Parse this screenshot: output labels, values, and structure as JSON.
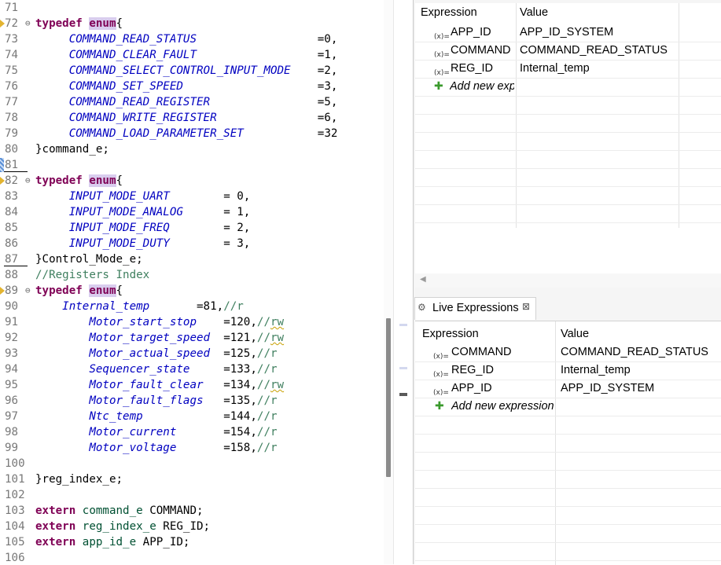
{
  "editor": {
    "lines": [
      {
        "n": "71"
      },
      {
        "n": "72",
        "fold": "⊖",
        "marker": "yellow",
        "kw": "typedef ",
        "kwh": "enum",
        "rest": "{"
      },
      {
        "n": "73",
        "indent": "     ",
        "cst": "COMMAND_READ_STATUS",
        "pad": "                  ",
        "val": "=0,"
      },
      {
        "n": "74",
        "indent": "     ",
        "cst": "COMMAND_CLEAR_FAULT",
        "pad": "                  ",
        "val": "=1,"
      },
      {
        "n": "75",
        "indent": "     ",
        "cst": "COMMAND_SELECT_CONTROL_INPUT_MODE",
        "pad": "    ",
        "val": "=2,"
      },
      {
        "n": "76",
        "indent": "     ",
        "cst": "COMMAND_SET_SPEED",
        "pad": "                    ",
        "val": "=3,"
      },
      {
        "n": "77",
        "indent": "     ",
        "cst": "COMMAND_READ_REGISTER",
        "pad": "                ",
        "val": "=5,"
      },
      {
        "n": "78",
        "indent": "     ",
        "cst": "COMMAND_WRITE_REGISTER",
        "pad": "               ",
        "val": "=6,"
      },
      {
        "n": "79",
        "indent": "     ",
        "cst": "COMMAND_LOAD_PARAMETER_SET",
        "pad": "           ",
        "val": "=32"
      },
      {
        "n": "80",
        "plain": "}command_e;"
      },
      {
        "n": "81",
        "marker": "blue",
        "underline": true
      },
      {
        "n": "82",
        "fold": "⊖",
        "marker": "yellow",
        "kw": "typedef ",
        "kwh": "enum",
        "rest": "{"
      },
      {
        "n": "83",
        "indent": "     ",
        "cst": "INPUT_MODE_UART",
        "pad": "        ",
        "val": "= 0,"
      },
      {
        "n": "84",
        "indent": "     ",
        "cst": "INPUT_MODE_ANALOG",
        "pad": "      ",
        "val": "= 1,"
      },
      {
        "n": "85",
        "indent": "     ",
        "cst": "INPUT_MODE_FREQ",
        "pad": "        ",
        "val": "= 2,"
      },
      {
        "n": "86",
        "indent": "     ",
        "cst": "INPUT_MODE_DUTY",
        "pad": "        ",
        "val": "= 3,"
      },
      {
        "n": "87",
        "plain": "}Control_Mode_e;",
        "underline": true
      },
      {
        "n": "88",
        "cm": "//Registers Index"
      },
      {
        "n": "89",
        "fold": "⊖",
        "marker": "yellow",
        "kw": "typedef ",
        "kwh": "enum",
        "rest": "{"
      },
      {
        "n": "90",
        "indent": "    ",
        "cst": "Internal_temp",
        "pad": "       ",
        "val": "=81,",
        "cm": "//r"
      },
      {
        "n": "91",
        "indent": "        ",
        "cst": "Motor_start_stop",
        "pad": "    ",
        "val": "=120,",
        "cm": "//",
        "cmsq": "rw"
      },
      {
        "n": "92",
        "indent": "        ",
        "cst": "Motor_target_speed",
        "pad": "  ",
        "val": "=121,",
        "cm": "//",
        "cmsq": "rw"
      },
      {
        "n": "93",
        "indent": "        ",
        "cst": "Motor_actual_speed",
        "pad": "  ",
        "val": "=125,",
        "cm": "//r"
      },
      {
        "n": "94",
        "indent": "        ",
        "cst": "Sequencer_state",
        "pad": "     ",
        "val": "=133,",
        "cm": "//r"
      },
      {
        "n": "95",
        "indent": "        ",
        "cst": "Motor_fault_clear",
        "pad": "   ",
        "val": "=134,",
        "cm": "//",
        "cmsq": "rw"
      },
      {
        "n": "96",
        "indent": "        ",
        "cst": "Motor_fault_flags",
        "pad": "   ",
        "val": "=135,",
        "cm": "//r"
      },
      {
        "n": "97",
        "indent": "        ",
        "cst": "Ntc_temp",
        "pad": "            ",
        "val": "=144,",
        "cm": "//r"
      },
      {
        "n": "98",
        "indent": "        ",
        "cst": "Motor_current",
        "pad": "       ",
        "val": "=154,",
        "cm": "//r"
      },
      {
        "n": "99",
        "indent": "        ",
        "cst": "Motor_voltage",
        "pad": "       ",
        "val": "=158,",
        "cm": "//r"
      },
      {
        "n": "100"
      },
      {
        "n": "101",
        "plain": "}reg_index_e;"
      },
      {
        "n": "102"
      },
      {
        "n": "103",
        "kw": "extern ",
        "typ": "command_e",
        "rest": " COMMAND;"
      },
      {
        "n": "104",
        "kw": "extern ",
        "typ": "reg_index_e",
        "rest": " REG_ID;"
      },
      {
        "n": "105",
        "kw": "extern ",
        "typ": "app_id_e",
        "rest": " APP_ID;"
      },
      {
        "n": "106"
      }
    ]
  },
  "expressions_panel": {
    "headers": {
      "expression": "Expression",
      "value": "Value"
    },
    "icon_glyph": "(x)=",
    "rows": [
      {
        "name": "APP_ID",
        "value": "APP_ID_SYSTEM"
      },
      {
        "name": "COMMAND",
        "value": "COMMAND_READ_STATUS"
      },
      {
        "name": "REG_ID",
        "value": "Internal_temp"
      }
    ],
    "add_label": "Add new exp"
  },
  "live_expressions": {
    "tab_title": "Live Expressions",
    "tab_close": "⊠",
    "headers": {
      "expression": "Expression",
      "value": "Value"
    },
    "icon_glyph": "(x)=",
    "rows": [
      {
        "name": "COMMAND",
        "value": "COMMAND_READ_STATUS"
      },
      {
        "name": "REG_ID",
        "value": "Internal_temp"
      },
      {
        "name": "APP_ID",
        "value": "APP_ID_SYSTEM"
      }
    ],
    "add_label": "Add new expression"
  },
  "colors": {
    "keyword": "#7f0055",
    "constant": "#0000c0",
    "comment": "#3f7f5f",
    "type": "#005032",
    "add": "#3a9a2c"
  }
}
